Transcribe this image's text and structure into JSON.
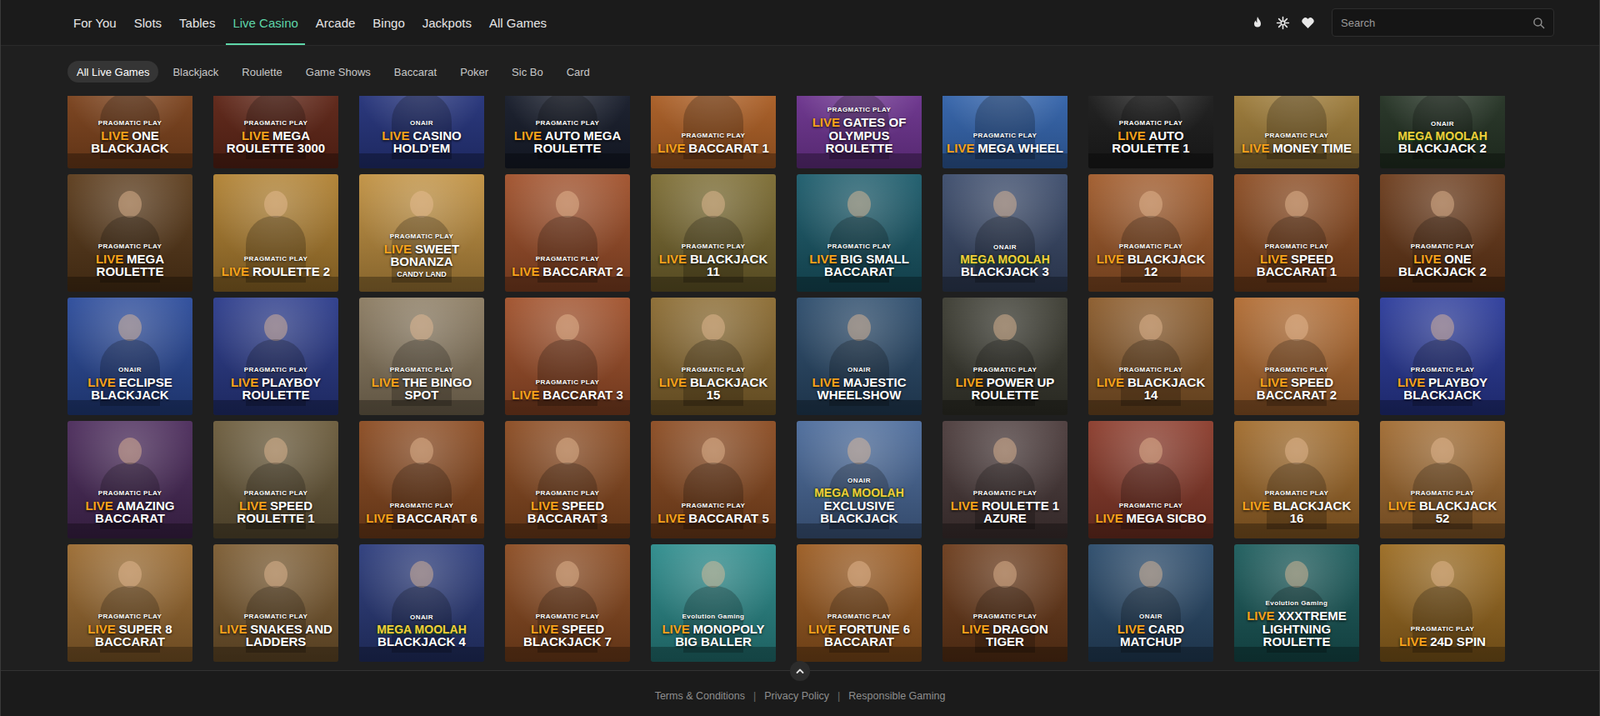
{
  "nav": {
    "items": [
      {
        "label": "For You",
        "selected": false
      },
      {
        "label": "Slots",
        "selected": false
      },
      {
        "label": "Tables",
        "selected": false
      },
      {
        "label": "Live Casino",
        "selected": true
      },
      {
        "label": "Arcade",
        "selected": false
      },
      {
        "label": "Bingo",
        "selected": false
      },
      {
        "label": "Jackpots",
        "selected": false
      },
      {
        "label": "All Games",
        "selected": false
      }
    ]
  },
  "search": {
    "placeholder": "Search"
  },
  "filters": [
    {
      "label": "All Live Games",
      "selected": true
    },
    {
      "label": "Blackjack",
      "selected": false
    },
    {
      "label": "Roulette",
      "selected": false
    },
    {
      "label": "Game Shows",
      "selected": false
    },
    {
      "label": "Baccarat",
      "selected": false
    },
    {
      "label": "Poker",
      "selected": false
    },
    {
      "label": "Sic Bo",
      "selected": false
    },
    {
      "label": "Card",
      "selected": false
    }
  ],
  "games": [
    {
      "kind": "live",
      "badge": "LIVE",
      "title": "ONE BLACKJACK",
      "provider": "PRAGMATIC PLAY",
      "color": "#8a4a20"
    },
    {
      "kind": "live",
      "badge": "LIVE",
      "title": "MEGA ROULETTE 3000",
      "provider": "PRAGMATIC PLAY",
      "color": "#6a2a1a"
    },
    {
      "kind": "live",
      "badge": "LIVE",
      "title": "CASINO HOLD'EM",
      "provider": "ONAIR",
      "color": "#2a3a8a"
    },
    {
      "kind": "live",
      "badge": "LIVE",
      "title": "AUTO MEGA ROULETTE",
      "provider": "PRAGMATIC PLAY",
      "color": "#1a2030"
    },
    {
      "kind": "live",
      "badge": "LIVE",
      "title": "BACCARAT 1",
      "provider": "PRAGMATIC PLAY",
      "color": "#c06a2a"
    },
    {
      "kind": "live",
      "badge": "LIVE",
      "title": "GATES OF OLYMPUS ROULETTE",
      "provider": "PRAGMATIC PLAY",
      "color": "#7a3aa0"
    },
    {
      "kind": "live",
      "badge": "LIVE",
      "title": "MEGA WHEEL",
      "provider": "PRAGMATIC PLAY",
      "color": "#3a70c0"
    },
    {
      "kind": "live",
      "badge": "LIVE",
      "title": "AUTO ROULETTE 1",
      "provider": "PRAGMATIC PLAY",
      "color": "#202020"
    },
    {
      "kind": "live",
      "badge": "LIVE",
      "title": "MONEY TIME",
      "provider": "PRAGMATIC PLAY",
      "color": "#b08a40"
    },
    {
      "kind": "moolah",
      "badge": "MEGA MOOLAH",
      "title": "BLACKJACK 2",
      "provider": "ONAIR",
      "color": "#2a3a2a"
    },
    {
      "kind": "live",
      "badge": "LIVE",
      "title": "MEGA ROULETTE",
      "provider": "PRAGMATIC PLAY",
      "color": "#5a3a1a"
    },
    {
      "kind": "live",
      "badge": "LIVE",
      "title": "ROULETTE 2",
      "provider": "PRAGMATIC PLAY",
      "color": "#b08030"
    },
    {
      "kind": "live",
      "badge": "LIVE",
      "title": "SWEET BONANZA",
      "subtitle": "CANDY LAND",
      "provider": "PRAGMATIC PLAY",
      "color": "#c09040"
    },
    {
      "kind": "live",
      "badge": "LIVE",
      "title": "BACCARAT 2",
      "provider": "PRAGMATIC PLAY",
      "color": "#a0502a"
    },
    {
      "kind": "live",
      "badge": "LIVE",
      "title": "BLACKJACK 11",
      "provider": "PRAGMATIC PLAY",
      "color": "#7a6a30"
    },
    {
      "kind": "live",
      "badge": "LIVE",
      "title": "BIG SMALL BACCARAT",
      "provider": "PRAGMATIC PLAY",
      "color": "#1a5a6a"
    },
    {
      "kind": "moolah",
      "badge": "MEGA MOOLAH",
      "title": "BLACKJACK 3",
      "provider": "ONAIR",
      "color": "#3a4a6a"
    },
    {
      "kind": "live",
      "badge": "LIVE",
      "title": "BLACKJACK 12",
      "provider": "PRAGMATIC PLAY",
      "color": "#a05a2a"
    },
    {
      "kind": "live",
      "badge": "LIVE",
      "title": "SPEED BACCARAT 1",
      "provider": "PRAGMATIC PLAY",
      "color": "#8a4a20"
    },
    {
      "kind": "live",
      "badge": "LIVE",
      "title": "ONE BLACKJACK 2",
      "provider": "PRAGMATIC PLAY",
      "color": "#6a3a1a"
    },
    {
      "kind": "live",
      "badge": "LIVE",
      "title": "ECLIPSE BLACKJACK",
      "provider": "ONAIR",
      "color": "#2a4a9a"
    },
    {
      "kind": "live",
      "badge": "LIVE",
      "title": "PLAYBOY ROULETTE",
      "provider": "PRAGMATIC PLAY",
      "color": "#2a3a8a"
    },
    {
      "kind": "live",
      "badge": "LIVE",
      "title": "THE BINGO SPOT",
      "provider": "PRAGMATIC PLAY",
      "color": "#8a7a60"
    },
    {
      "kind": "live",
      "badge": "LIVE",
      "title": "BACCARAT 3",
      "provider": "PRAGMATIC PLAY",
      "color": "#a0502a"
    },
    {
      "kind": "live",
      "badge": "LIVE",
      "title": "BLACKJACK 15",
      "provider": "PRAGMATIC PLAY",
      "color": "#8a6a30"
    },
    {
      "kind": "live",
      "badge": "LIVE",
      "title": "MAJESTIC WHEELSHOW",
      "provider": "ONAIR",
      "color": "#2a4a6a"
    },
    {
      "kind": "live",
      "badge": "LIVE",
      "title": "POWER UP ROULETTE",
      "provider": "PRAGMATIC PLAY",
      "color": "#3a3a30"
    },
    {
      "kind": "live",
      "badge": "LIVE",
      "title": "BLACKJACK 14",
      "provider": "PRAGMATIC PLAY",
      "color": "#8a5a2a"
    },
    {
      "kind": "live",
      "badge": "LIVE",
      "title": "SPEED BACCARAT 2",
      "provider": "PRAGMATIC PLAY",
      "color": "#b06a30"
    },
    {
      "kind": "live",
      "badge": "LIVE",
      "title": "PLAYBOY BLACKJACK",
      "provider": "PRAGMATIC PLAY",
      "color": "#2a3a9a"
    },
    {
      "kind": "live",
      "badge": "LIVE",
      "title": "AMAZING BACCARAT",
      "provider": "PRAGMATIC PLAY",
      "color": "#4a2a5a"
    },
    {
      "kind": "live",
      "badge": "LIVE",
      "title": "SPEED ROULETTE 1",
      "provider": "PRAGMATIC PLAY",
      "color": "#6a5a3a"
    },
    {
      "kind": "live",
      "badge": "LIVE",
      "title": "BACCARAT 6",
      "provider": "PRAGMATIC PLAY",
      "color": "#8a4a20"
    },
    {
      "kind": "live",
      "badge": "LIVE",
      "title": "SPEED BACCARAT 3",
      "provider": "PRAGMATIC PLAY",
      "color": "#8a4a20"
    },
    {
      "kind": "live",
      "badge": "LIVE",
      "title": "BACCARAT 5",
      "provider": "PRAGMATIC PLAY",
      "color": "#8a4a20"
    },
    {
      "kind": "moolah",
      "badge": "MEGA MOOLAH",
      "title": "EXCLUSIVE BLACKJACK",
      "provider": "ONAIR",
      "color": "#4a6a9a"
    },
    {
      "kind": "live",
      "badge": "LIVE",
      "title": "ROULETTE 1 AZURE",
      "provider": "PRAGMATIC PLAY",
      "color": "#4a3a3a"
    },
    {
      "kind": "live",
      "badge": "LIVE",
      "title": "MEGA SICBO",
      "provider": "PRAGMATIC PLAY",
      "color": "#8a3a2a"
    },
    {
      "kind": "live",
      "badge": "LIVE",
      "title": "BLACKJACK 16",
      "provider": "PRAGMATIC PLAY",
      "color": "#a06a2a"
    },
    {
      "kind": "live",
      "badge": "LIVE",
      "title": "BLACKJACK 52",
      "provider": "PRAGMATIC PLAY",
      "color": "#a06a30"
    },
    {
      "kind": "live",
      "badge": "LIVE",
      "title": "SUPER 8 BACCARAT",
      "provider": "PRAGMATIC PLAY",
      "color": "#9a6a30"
    },
    {
      "kind": "live",
      "badge": "LIVE",
      "title": "SNAKES AND LADDERS",
      "provider": "PRAGMATIC PLAY",
      "color": "#7a5a30"
    },
    {
      "kind": "moolah",
      "badge": "MEGA MOOLAH",
      "title": "BLACKJACK 4",
      "provider": "ONAIR",
      "color": "#2a3a7a"
    },
    {
      "kind": "live",
      "badge": "LIVE",
      "title": "SPEED BLACKJACK 7",
      "provider": "PRAGMATIC PLAY",
      "color": "#8a4a20"
    },
    {
      "kind": "live",
      "badge": "LIVE",
      "title": "MONOPOLY BIG BALLER",
      "provider": "Evolution Gaming",
      "color": "#2a8a8a"
    },
    {
      "kind": "live",
      "badge": "LIVE",
      "title": "FORTUNE 6 BACCARAT",
      "provider": "PRAGMATIC PLAY",
      "color": "#9a5a20"
    },
    {
      "kind": "live",
      "badge": "LIVE",
      "title": "DRAGON TIGER",
      "provider": "PRAGMATIC PLAY",
      "color": "#6a3a1a"
    },
    {
      "kind": "live",
      "badge": "LIVE",
      "title": "CARD MATCHUP",
      "provider": "ONAIR",
      "color": "#2a4a6a"
    },
    {
      "kind": "live",
      "badge": "LIVE",
      "title": "XXXTREME LIGHTNING ROULETTE",
      "provider": "Evolution Gaming",
      "color": "#1a5a5a"
    },
    {
      "kind": "live",
      "badge": "LIVE",
      "title": "24D SPIN",
      "provider": "PRAGMATIC PLAY",
      "color": "#9a6a20"
    }
  ],
  "footer": {
    "links": [
      "Terms & Conditions",
      "Privacy Policy",
      "Responsible Gaming"
    ],
    "separator": "|"
  }
}
